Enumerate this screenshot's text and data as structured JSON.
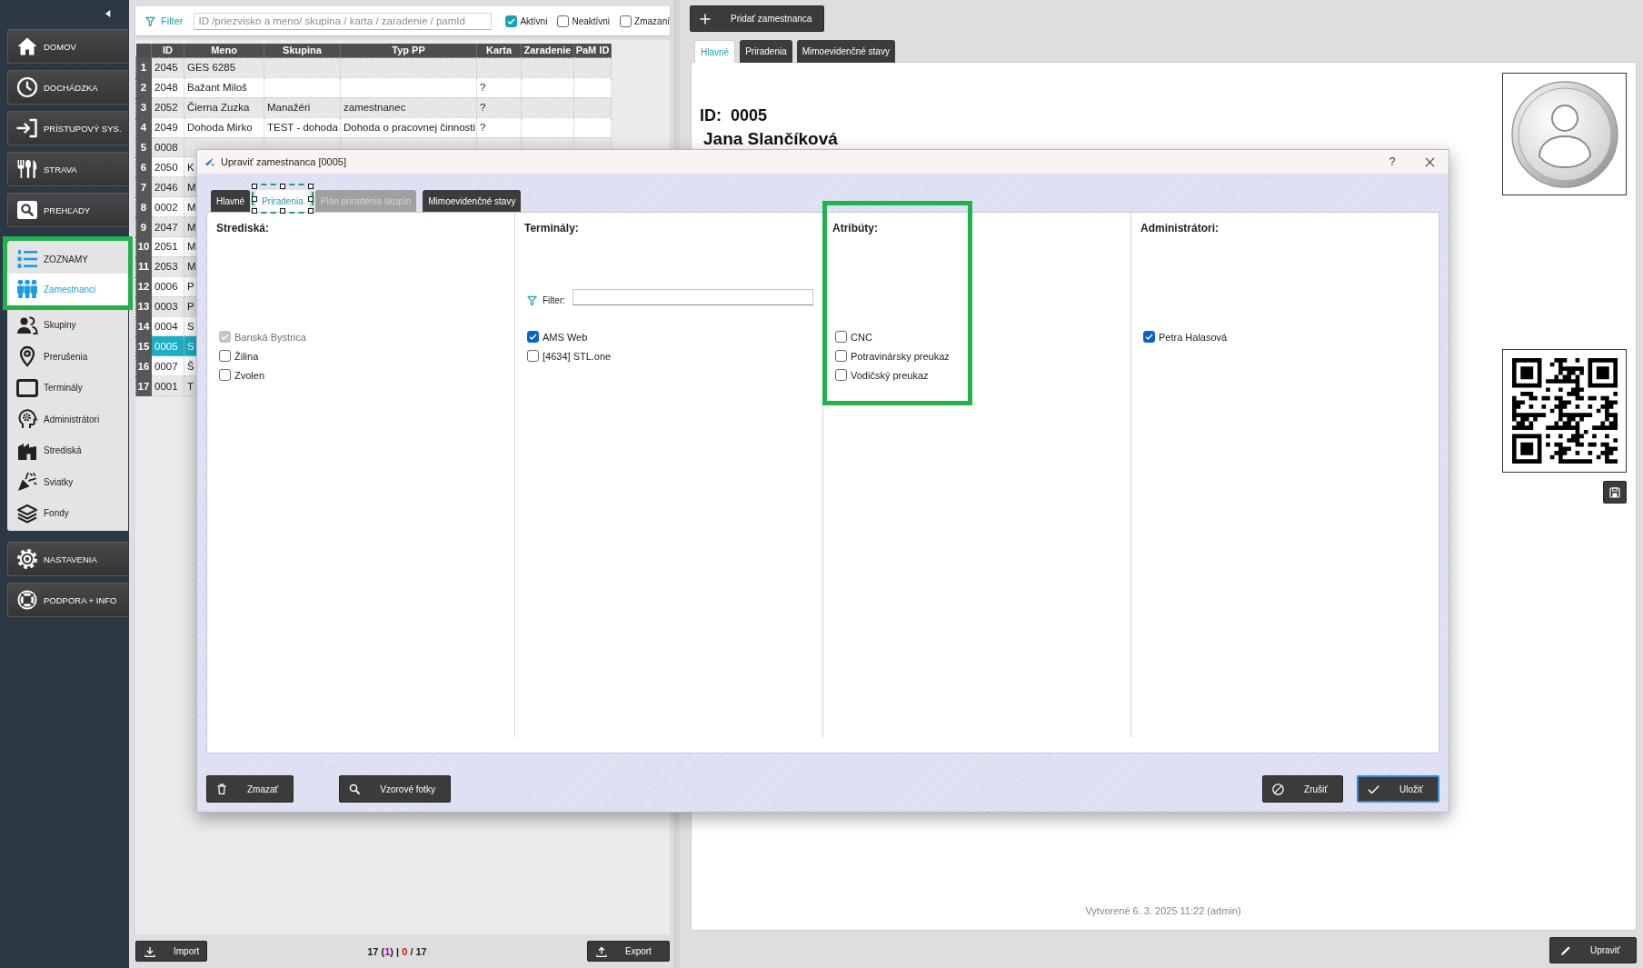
{
  "sidebar": {
    "menu": [
      {
        "kind": "button",
        "label": "DOMOV",
        "highlighted": false
      },
      {
        "kind": "button",
        "label": "DOCHÁDZKA",
        "highlighted": false
      },
      {
        "kind": "button",
        "label": "PRÍSTUPOVÝ SYS.",
        "highlighted": false
      },
      {
        "kind": "button",
        "label": "STRAVA",
        "highlighted": false
      },
      {
        "kind": "button",
        "label": "PREHĽADY",
        "highlighted": false
      },
      {
        "kind": "section",
        "label": "ZOZNAMY",
        "highlighted": true,
        "children": [
          {
            "label": "Zamestnanci",
            "selected": true
          },
          {
            "label": "Skupiny",
            "selected": false
          },
          {
            "label": "Prerušenia",
            "selected": false
          },
          {
            "label": "Terminály",
            "selected": false
          },
          {
            "label": "Administrátori",
            "selected": false
          },
          {
            "label": "Strediská",
            "selected": false
          },
          {
            "label": "Sviatky",
            "selected": false
          },
          {
            "label": "Fondy",
            "selected": false
          }
        ]
      },
      {
        "kind": "button",
        "label": "NASTAVENIA",
        "highlighted": false
      },
      {
        "kind": "button",
        "label": "PODPORA + INFO",
        "highlighted": false
      }
    ]
  },
  "employee_list": {
    "filter": {
      "label": "Filter",
      "placeholder": "ID /priezvisko a meno/ skupina / karta / zaradenie / pamId"
    },
    "status_filters": [
      {
        "label": "Aktívni",
        "checked": true
      },
      {
        "label": "Neaktívni",
        "checked": false
      },
      {
        "label": "Zmazaní",
        "checked": false
      }
    ],
    "table": {
      "columns": [
        "ID",
        "Meno",
        "Skupina",
        "Typ PP",
        "Karta",
        "Zaradenie",
        "PaM ID"
      ],
      "rows": [
        {
          "number": "1",
          "id": "2045",
          "meno": "GES 6285",
          "selected": false
        },
        {
          "number": "2",
          "id": "2048",
          "meno": "Bažant Miloš",
          "karta": "?",
          "selected": false
        },
        {
          "number": "3",
          "id": "2052",
          "meno": "Čierna Zuzka",
          "skupina": "Manažéri",
          "typ_pp": "zamestnanec",
          "karta": "?",
          "selected": false
        },
        {
          "number": "4",
          "id": "2049",
          "meno": "Dohoda Mirko",
          "skupina": "TEST - dohoda",
          "typ_pp": "Dohoda o pracovnej činnosti",
          "karta": "?",
          "selected": false
        },
        {
          "number": "5",
          "id": "0008",
          "selected": false
        },
        {
          "number": "6",
          "id": "2050",
          "meno": "K",
          "selected": false
        },
        {
          "number": "7",
          "id": "2046",
          "meno": "M",
          "selected": false
        },
        {
          "number": "8",
          "id": "0002",
          "meno": "M",
          "selected": false
        },
        {
          "number": "9",
          "id": "2047",
          "meno": "M",
          "selected": false
        },
        {
          "number": "10",
          "id": "2051",
          "meno": "M",
          "selected": false
        },
        {
          "number": "11",
          "id": "2053",
          "meno": "M",
          "selected": false
        },
        {
          "number": "12",
          "id": "0006",
          "meno": "P",
          "selected": false
        },
        {
          "number": "13",
          "id": "0003",
          "meno": "P",
          "selected": false
        },
        {
          "number": "14",
          "id": "0004",
          "meno": "S",
          "selected": false
        },
        {
          "number": "15",
          "id": "0005",
          "meno": "S",
          "selected": true
        },
        {
          "number": "16",
          "id": "0007",
          "meno": "Š",
          "selected": false
        },
        {
          "number": "17",
          "id": "0001",
          "meno": "T",
          "selected": false
        }
      ]
    },
    "import_button": "Import",
    "counter": [
      {
        "text": "17 (",
        "kind": "plain"
      },
      {
        "text": "1",
        "kind": "selected"
      },
      {
        "text": ") | ",
        "kind": "plain"
      },
      {
        "text": "0",
        "kind": "deleted"
      },
      {
        "text": " / 17",
        "kind": "plain"
      }
    ],
    "export_button": "Export"
  },
  "detail": {
    "add_button": "Pridať zamestnanca",
    "tabs": [
      {
        "label": "Hlavné",
        "selected": true
      },
      {
        "label": "Priradenia",
        "selected": false
      },
      {
        "label": "Mimoevidenčné stavy",
        "selected": false
      }
    ],
    "id_label": "ID:",
    "id_value": "0005",
    "name": "Jana Slančíková",
    "created": "Vytvorené 6. 3. 2025 11:22 (admin)",
    "edit_button": "Upraviť"
  },
  "dialog": {
    "title": "Upraviť zamestnanca [0005]",
    "help_button": "?",
    "tabs": [
      {
        "label": "Hlavné",
        "selected": false,
        "disabled": false,
        "highlighted": false
      },
      {
        "label": "Priradenia",
        "selected": true,
        "disabled": false,
        "highlighted": true
      },
      {
        "label": "Plán priradenia skupín",
        "selected": false,
        "disabled": true,
        "highlighted": false
      },
      {
        "label": "Mimoevidenčné stavy",
        "selected": false,
        "disabled": false,
        "highlighted": false
      }
    ],
    "columns": [
      {
        "title": "Strediská:",
        "highlighted": false,
        "items": [
          {
            "label": "Banská Bystrica",
            "checked": true,
            "disabled": true
          },
          {
            "label": "Žilina",
            "checked": false,
            "disabled": false
          },
          {
            "label": "Zvolen",
            "checked": false,
            "disabled": false
          }
        ]
      },
      {
        "title": "Terminály:",
        "highlighted": false,
        "filter": {
          "label": "Filter:"
        },
        "items": [
          {
            "label": "AMS Web",
            "checked": true,
            "disabled": false
          },
          {
            "label": "[4634] STL.one",
            "checked": false,
            "disabled": false
          }
        ]
      },
      {
        "title": "Atribúty:",
        "highlighted": true,
        "items": [
          {
            "label": "CNC",
            "checked": false,
            "disabled": false
          },
          {
            "label": "Potravinársky preukaz",
            "checked": false,
            "disabled": false
          },
          {
            "label": "Vodičský preukaz",
            "checked": false,
            "disabled": false
          }
        ]
      },
      {
        "title": "Administrátori:",
        "highlighted": false,
        "items": [
          {
            "label": "Petra Halasová",
            "checked": true,
            "disabled": false
          }
        ]
      }
    ],
    "actions_left": [
      {
        "label": "Zmazať",
        "focused": false
      },
      {
        "label": "Vzorové fotky",
        "focused": false
      }
    ],
    "actions_right": [
      {
        "label": "Zrušiť",
        "focused": false
      },
      {
        "label": "Uložiť",
        "focused": true
      }
    ]
  }
}
